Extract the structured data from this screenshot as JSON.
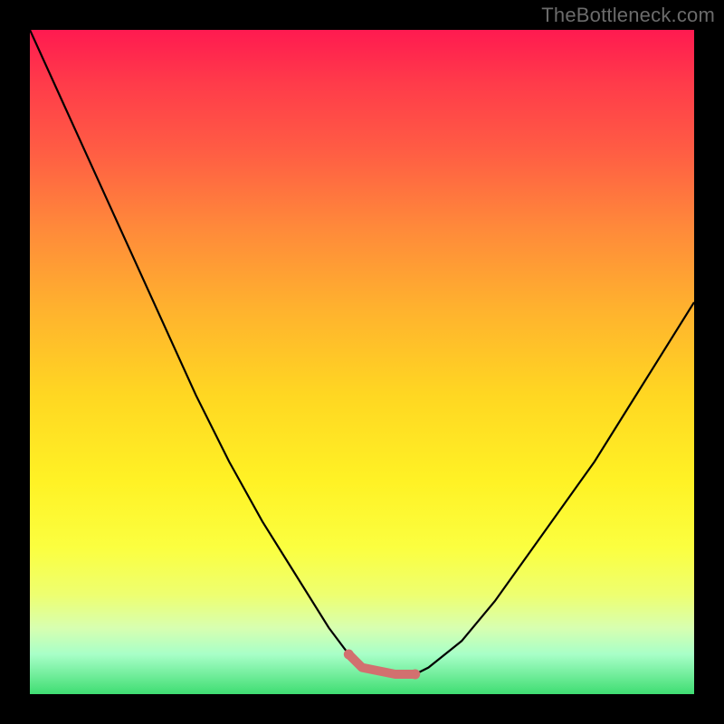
{
  "watermark": "TheBottleneck.com",
  "chart_data": {
    "type": "line",
    "title": "",
    "xlabel": "",
    "ylabel": "",
    "xlim": [
      0,
      100
    ],
    "ylim": [
      0,
      100
    ],
    "background_gradient": {
      "top": "#ff1a50",
      "middle": "#fff225",
      "bottom": "#3fdd72"
    },
    "series": [
      {
        "name": "curve",
        "color": "#000000",
        "x": [
          0,
          5,
          10,
          15,
          20,
          25,
          30,
          35,
          40,
          45,
          48,
          50,
          55,
          58,
          60,
          65,
          70,
          75,
          80,
          85,
          90,
          95,
          100
        ],
        "y": [
          100,
          89,
          78,
          67,
          56,
          45,
          35,
          26,
          18,
          10,
          6,
          4,
          3,
          3,
          4,
          8,
          14,
          21,
          28,
          35,
          43,
          51,
          59
        ]
      },
      {
        "name": "highlight-segment",
        "color": "#d2706f",
        "x": [
          48,
          50,
          55,
          58
        ],
        "y": [
          6,
          4,
          3,
          3
        ]
      }
    ]
  }
}
